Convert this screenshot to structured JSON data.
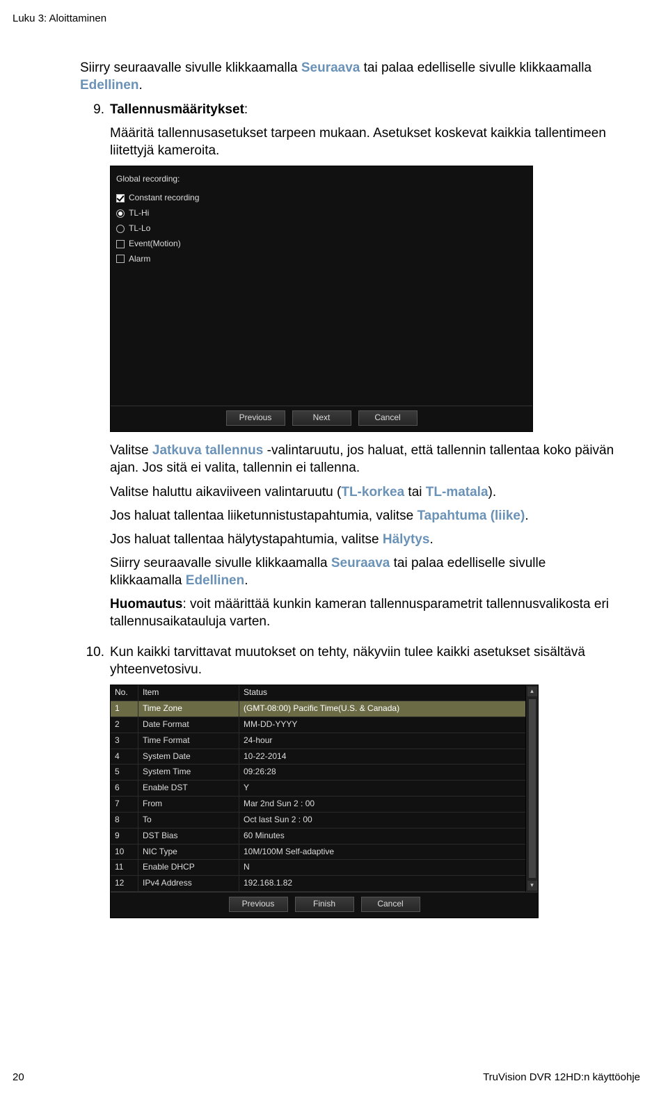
{
  "header": {
    "chapter": "Luku 3: Aloittaminen"
  },
  "intro": {
    "line1a": "Siirry seuraavalle sivulle klikkaamalla ",
    "seuraava": "Seuraava",
    "line1b": " tai palaa edelliselle sivulle klikkaamalla ",
    "edellinen": "Edellinen",
    "dot": "."
  },
  "item9": {
    "num": "9.",
    "title": "Tallennusmääritykset",
    "colon": ":",
    "body": "Määritä tallennusasetukset tarpeen mukaan. Asetukset koskevat kaikkia tallentimeen liitettyjä kameroita."
  },
  "screenshot1": {
    "heading": "Global recording:",
    "options": {
      "constant": "Constant recording",
      "tlhi": "TL-Hi",
      "tllo": "TL-Lo",
      "event": "Event(Motion)",
      "alarm": "Alarm"
    },
    "buttons": {
      "prev": "Previous",
      "next": "Next",
      "cancel": "Cancel"
    }
  },
  "mid": {
    "p1a": "Valitse ",
    "jatkuva": "Jatkuva tallennus",
    "p1b": " -valintaruutu, jos haluat, että tallennin tallentaa koko päivän ajan. Jos sitä ei valita, tallennin ei tallenna.",
    "p2a": "Valitse haluttu aikaviiveen valintaruutu (",
    "tlkorkea": "TL-korkea",
    "tai": " tai ",
    "tlmatala": "TL-matala",
    "p2b": ").",
    "p3a": "Jos haluat tallentaa liiketunnistustapahtumia, valitse ",
    "tapahtuma": "Tapahtuma (liike)",
    "p3b": ".",
    "p4a": "Jos haluat tallentaa hälytystapahtumia, valitse ",
    "halytys": "Hälytys",
    "p4b": ".",
    "p5a": "Siirry seuraavalle sivulle klikkaamalla ",
    "seuraava2": "Seuraava",
    "p5b": " tai palaa edelliselle sivulle klikkaamalla ",
    "edellinen2": "Edellinen",
    "p5c": ".",
    "huom_label": "Huomautus",
    "huom_body": ": voit määrittää kunkin kameran tallennusparametrit tallennusvalikosta eri tallennusaikatauluja varten."
  },
  "item10": {
    "num": "10.",
    "body": "Kun kaikki tarvittavat muutokset on tehty, näkyviin tulee kaikki asetukset sisältävä yhteenvetosivu."
  },
  "screenshot2": {
    "head": {
      "no": "No.",
      "item": "Item",
      "status": "Status"
    },
    "rows": [
      {
        "no": "1",
        "item": "Time Zone",
        "status": "(GMT-08:00) Pacific Time(U.S. & Canada)"
      },
      {
        "no": "2",
        "item": "Date Format",
        "status": "MM-DD-YYYY"
      },
      {
        "no": "3",
        "item": "Time Format",
        "status": "24-hour"
      },
      {
        "no": "4",
        "item": "System Date",
        "status": "10-22-2014"
      },
      {
        "no": "5",
        "item": "System Time",
        "status": "09:26:28"
      },
      {
        "no": "6",
        "item": "Enable DST",
        "status": "Y"
      },
      {
        "no": "7",
        "item": "From",
        "status": "Mar 2nd Sun 2 : 00"
      },
      {
        "no": "8",
        "item": "To",
        "status": "Oct last Sun 2 : 00"
      },
      {
        "no": "9",
        "item": "DST Bias",
        "status": "60 Minutes"
      },
      {
        "no": "10",
        "item": "NIC Type",
        "status": "10M/100M Self-adaptive"
      },
      {
        "no": "11",
        "item": "Enable DHCP",
        "status": "N"
      },
      {
        "no": "12",
        "item": "IPv4 Address",
        "status": "192.168.1.82"
      }
    ],
    "buttons": {
      "prev": "Previous",
      "finish": "Finish",
      "cancel": "Cancel"
    }
  },
  "footer": {
    "page": "20",
    "title": "TruVision DVR 12HD:n käyttöohje"
  }
}
